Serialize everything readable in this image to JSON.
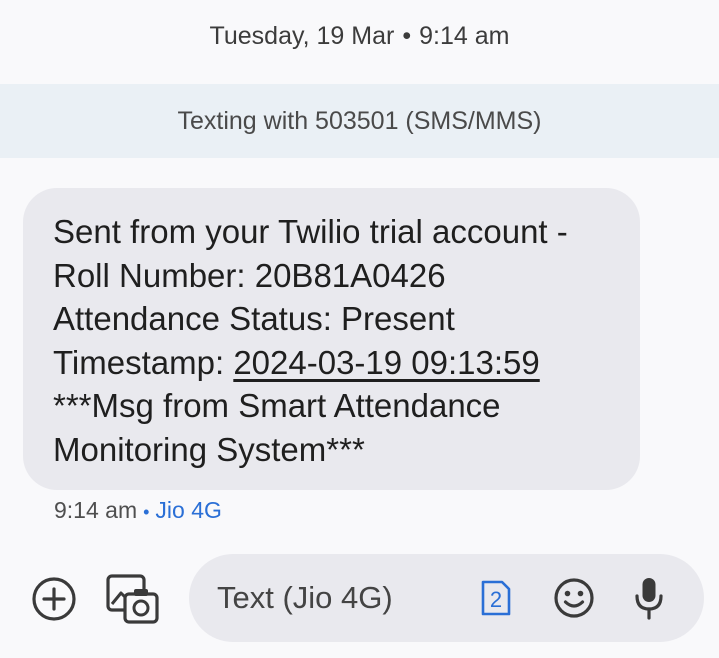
{
  "header": {
    "date": "Tuesday, 19 Mar",
    "separator": "•",
    "time": "9:14 am"
  },
  "banner": {
    "text": "Texting with 503501 (SMS/MMS)"
  },
  "message": {
    "line1": "Sent from your Twilio trial account -",
    "line2": "Roll Number: 20B81A0426",
    "line3": "Attendance Status: Present",
    "line4_prefix": "Timestamp: ",
    "line4_link": "2024-03-19 09:13:59",
    "line5": "***Msg from Smart Attendance",
    "line6": "Monitoring System***"
  },
  "meta": {
    "time": "9:14 am",
    "separator": "•",
    "network": "Jio 4G"
  },
  "compose": {
    "placeholder": "Text (Jio 4G)",
    "sim_number": "2"
  },
  "icons": {
    "add": "add-circle-icon",
    "gallery": "gallery-camera-icon",
    "sim": "sim-card-icon",
    "emoji": "emoji-icon",
    "mic": "microphone-icon"
  },
  "colors": {
    "background": "#f9f9fb",
    "banner": "#eaf0f5",
    "bubble": "#e9e9ee",
    "accent": "#2a6fd6"
  }
}
